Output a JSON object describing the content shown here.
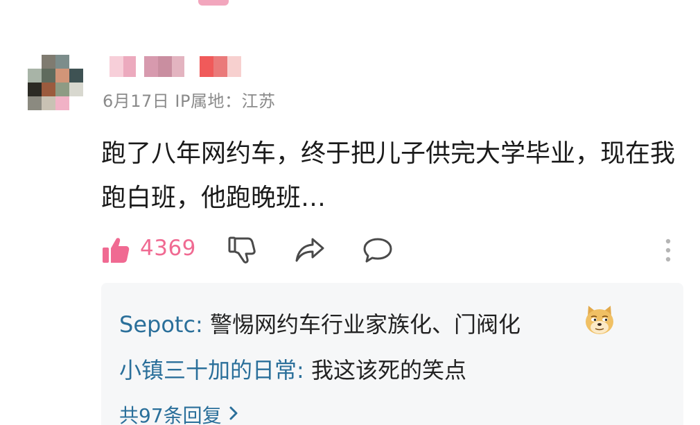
{
  "comment": {
    "meta": "6月17日 IP属地：江苏",
    "text": "跑了八年网约车，终于把儿子供完大学毕业，现在我跑白班，他跑晚班…",
    "like_count": "4369"
  },
  "icons": {
    "like": "thumbs-up-icon",
    "dislike": "thumbs-down-icon",
    "share": "share-icon",
    "comment": "comment-bubble-icon",
    "more": "vertical-dots-icon",
    "emoji": "doge-emoji-icon",
    "chevron": "chevron-right-icon"
  },
  "replies": [
    {
      "author": "Sepotc",
      "separator": ": ",
      "body": "警惕网约车行业家族化、门阀化"
    },
    {
      "author": "小镇三十加的日常",
      "separator": ": ",
      "body": "我这该死的笑点"
    }
  ],
  "more_replies_label": "共97条回复",
  "colors": {
    "accent_pink": "#f06a92",
    "link_blue": "#2a6f9a",
    "meta_gray": "#8a8a8a",
    "reply_bg": "#f6f7f8"
  }
}
